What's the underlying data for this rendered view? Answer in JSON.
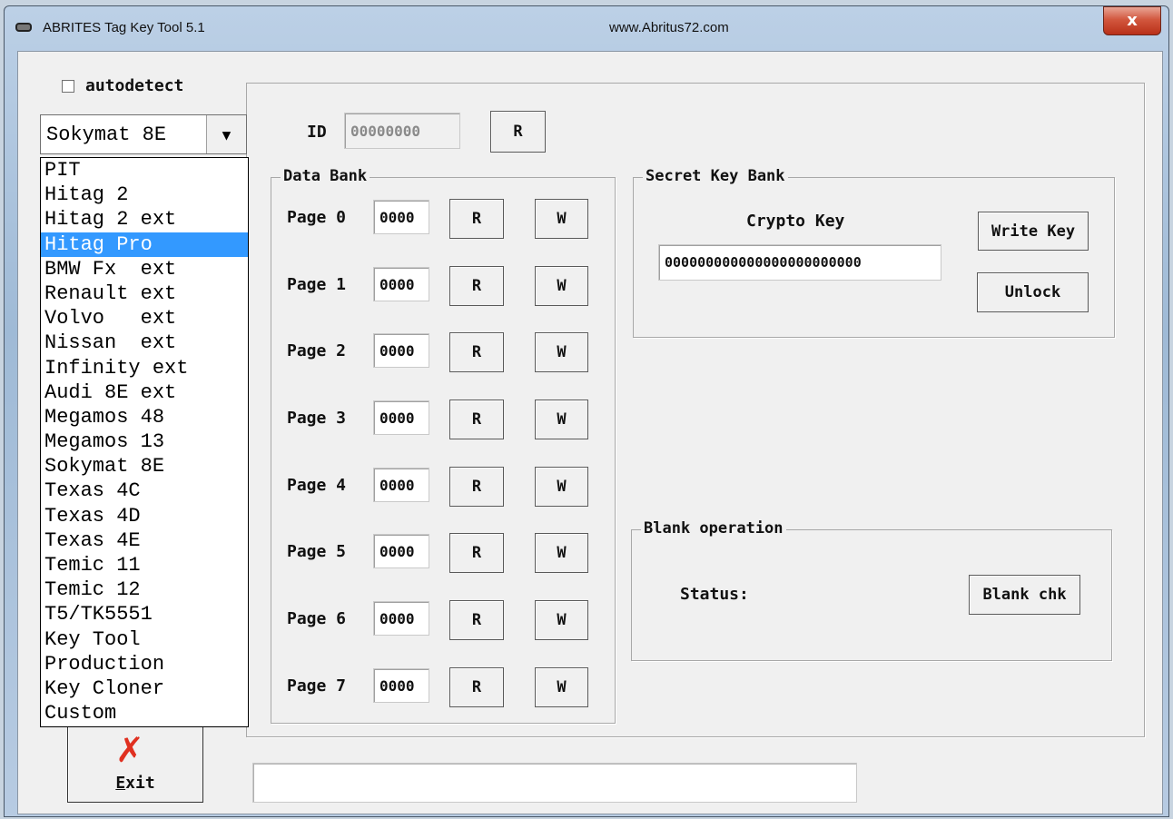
{
  "window": {
    "title": "ABRITES Tag Key Tool 5.1",
    "url": "www.Abritus72.com",
    "close": "x"
  },
  "autodetect": {
    "label": "autodetect",
    "checked": false
  },
  "transponder_select": {
    "value": "Sokymat 8E",
    "options": [
      "PIT",
      "Hitag 2",
      "Hitag 2 ext",
      "Hitag Pro",
      "BMW Fx  ext",
      "Renault ext",
      "Volvo   ext",
      "Nissan  ext",
      "Infinity ext",
      "Audi 8E ext",
      "Megamos 48",
      "Megamos 13",
      "Sokymat 8E",
      "Texas 4C",
      "Texas 4D",
      "Texas 4E",
      "Temic 11",
      "Temic 12",
      "T5/TK5551",
      "Key Tool",
      "Production",
      "Key Cloner",
      "Custom"
    ],
    "highlighted": "Hitag Pro"
  },
  "id": {
    "label": "ID",
    "value": "00000000",
    "read_label": "R"
  },
  "data_bank": {
    "title": "Data Bank",
    "pages": [
      {
        "label": "Page 0",
        "value": "0000",
        "read": "R",
        "write": "W"
      },
      {
        "label": "Page 1",
        "value": "0000",
        "read": "R",
        "write": "W"
      },
      {
        "label": "Page 2",
        "value": "0000",
        "read": "R",
        "write": "W"
      },
      {
        "label": "Page 3",
        "value": "0000",
        "read": "R",
        "write": "W"
      },
      {
        "label": "Page 4",
        "value": "0000",
        "read": "R",
        "write": "W"
      },
      {
        "label": "Page 5",
        "value": "0000",
        "read": "R",
        "write": "W"
      },
      {
        "label": "Page 6",
        "value": "0000",
        "read": "R",
        "write": "W"
      },
      {
        "label": "Page 7",
        "value": "0000",
        "read": "R",
        "write": "W"
      }
    ]
  },
  "secret_key_bank": {
    "title": "Secret Key Bank",
    "crypto_label": "Crypto Key",
    "crypto_value": "000000000000000000000000",
    "write_key_label": "Write Key",
    "unlock_label": "Unlock"
  },
  "blank_operation": {
    "title": "Blank operation",
    "status_label": "Status:",
    "blank_chk_label": "Blank chk"
  },
  "exit": {
    "label": "Exit",
    "icon": "red-x-icon"
  },
  "status_bar": {
    "text": ""
  },
  "colors": {
    "selection": "#3399ff",
    "exit_icon": "#e03020",
    "close_button": "#c8452c"
  }
}
